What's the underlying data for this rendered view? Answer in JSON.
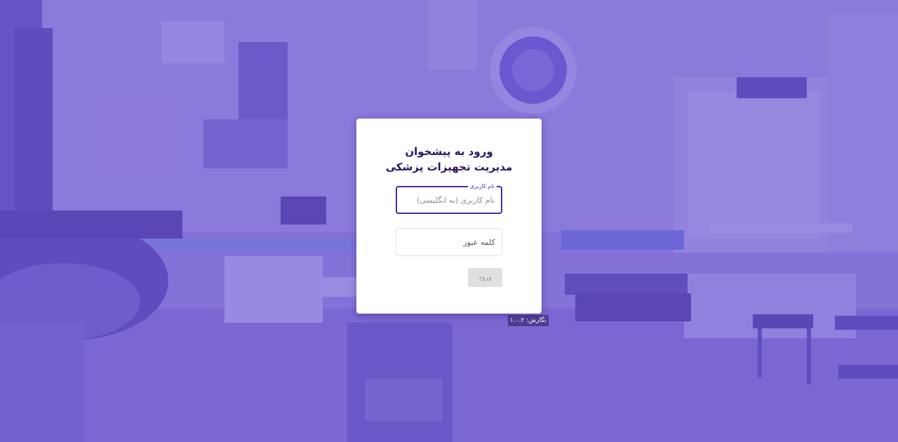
{
  "login": {
    "title_line1": "ورود به پیشخوان",
    "title_line2": "مدیریت تجهیزات پزشکی",
    "username": {
      "label": "نام کاربری",
      "placeholder": "نام کاربری (به انگلیسی)",
      "value": ""
    },
    "password": {
      "placeholder": "کلمه عبور",
      "value": ""
    },
    "submit_label": "ورود"
  },
  "footer": {
    "version_text": "نگارش: ۱.۰.۲"
  },
  "colors": {
    "background_tint": "#6850cd",
    "accent": "#4b2aa2",
    "title": "#2c1660",
    "button_disabled_bg": "#e0e0e0",
    "button_disabled_text": "#9e9e9e"
  }
}
